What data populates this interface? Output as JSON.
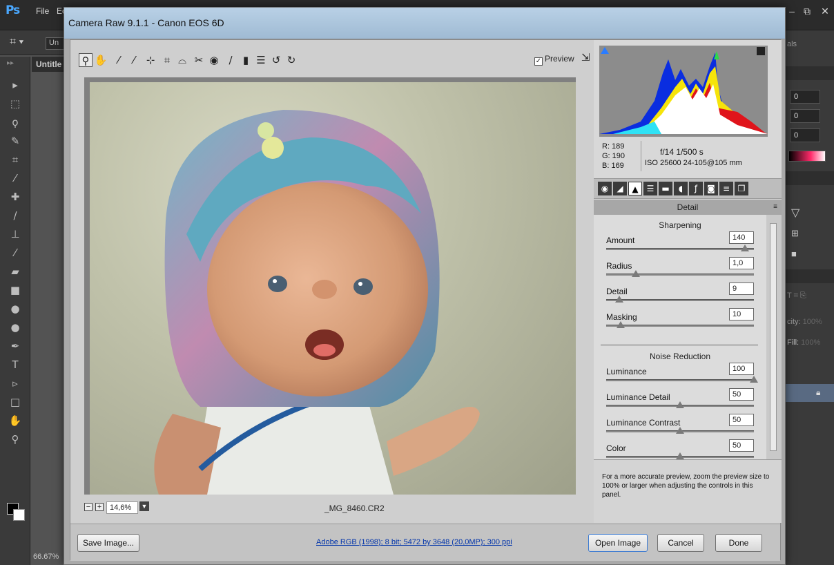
{
  "photoshop": {
    "logo": "Ps",
    "menu_first": "File",
    "menu_second": "Ec",
    "options_field": "Un",
    "doc_tab": "Untitle",
    "zoom": "66.67%",
    "right_panel": {
      "field1": "0",
      "field2": "0",
      "field3": "0",
      "tab_label": "als",
      "opacity_label": "city:",
      "opacity_value": "100%",
      "fill_label": "Fill:",
      "fill_value": "100%"
    }
  },
  "camera_raw": {
    "title": "Camera Raw 9.1.1  -  Canon EOS 6D",
    "preview_label": "Preview",
    "zoom_value": "14,6%",
    "filename": "_MG_8460.CR2",
    "readout": {
      "r": "R:  189",
      "g": "G:  190",
      "b": "B:  169",
      "aperture_shutter": "f/14   1/500 s",
      "iso_lens": "ISO 25600   24-105@105 mm"
    },
    "panel_title": "Detail",
    "sharpening": {
      "title": "Sharpening",
      "sliders": [
        {
          "label": "Amount",
          "value": "140",
          "frac": 0.94
        },
        {
          "label": "Radius",
          "value": "1,0",
          "frac": 0.2
        },
        {
          "label": "Detail",
          "value": "9",
          "frac": 0.09
        },
        {
          "label": "Masking",
          "value": "10",
          "frac": 0.1
        }
      ]
    },
    "noise_reduction": {
      "title": "Noise Reduction",
      "sliders": [
        {
          "label": "Luminance",
          "value": "100",
          "frac": 1.0
        },
        {
          "label": "Luminance Detail",
          "value": "50",
          "frac": 0.5
        },
        {
          "label": "Luminance Contrast",
          "value": "50",
          "frac": 0.5
        },
        {
          "label": "Color",
          "value": "50",
          "frac": 0.5
        }
      ]
    },
    "tip": "For a more accurate preview, zoom the preview size to 100% or larger when adjusting the controls in this panel.",
    "footer": {
      "save_label": "Save Image...",
      "workflow_link": "Adobe RGB (1998); 8 bit; 5472 by 3648 (20,0MP); 300 ppi",
      "open_label": "Open Image",
      "cancel_label": "Cancel",
      "done_label": "Done"
    }
  }
}
